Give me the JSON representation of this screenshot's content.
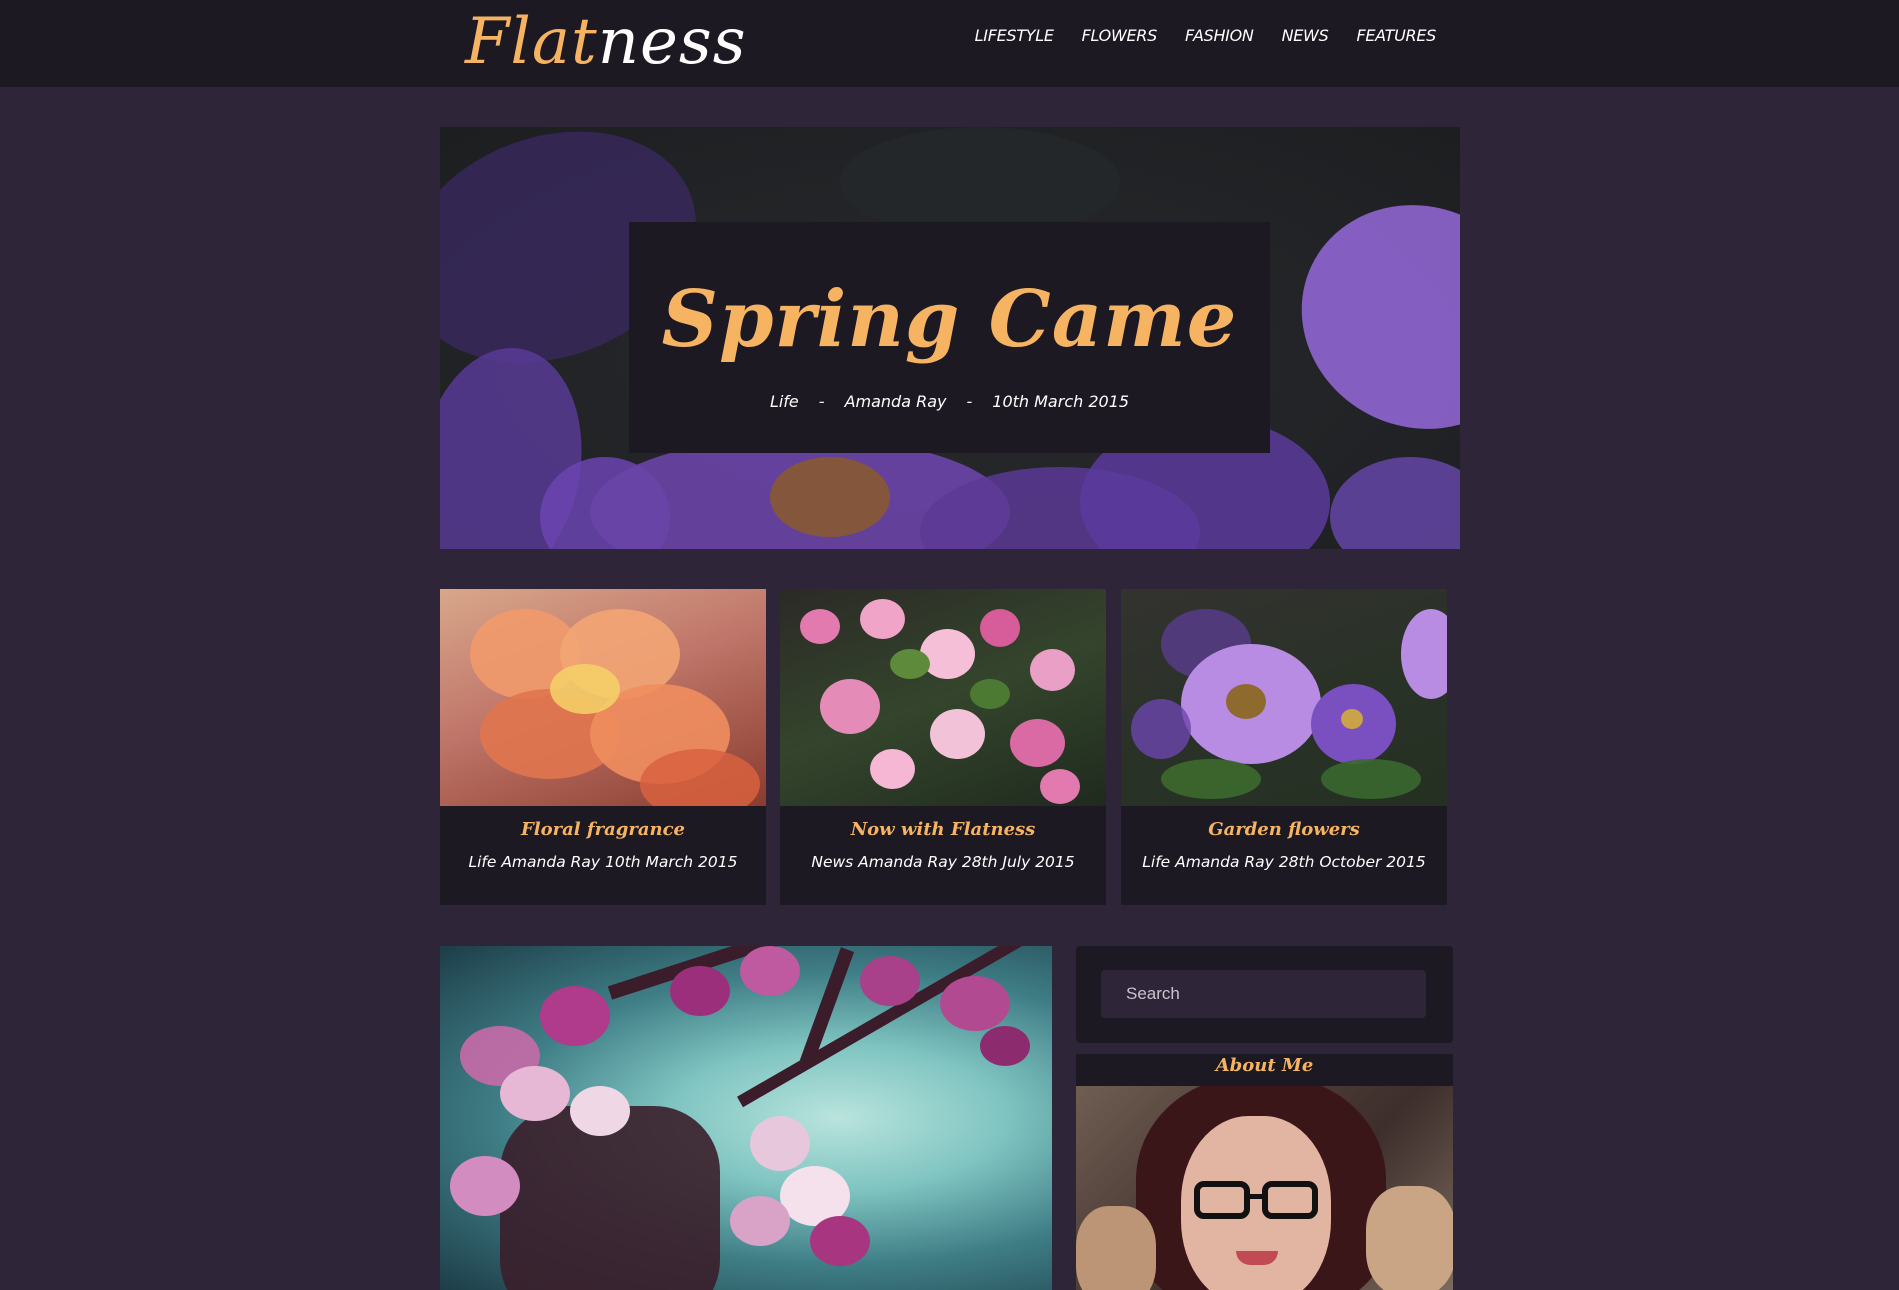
{
  "header": {
    "logo_part1": "Flat",
    "logo_part2": "ness",
    "nav": [
      "LIFESTYLE",
      "FLOWERS",
      "FASHION",
      "NEWS",
      "FEATURES"
    ]
  },
  "hero": {
    "title": "Spring Came",
    "category": "Life",
    "separator": "-",
    "author": "Amanda Ray",
    "date": "10th March 2015"
  },
  "cards": [
    {
      "title": "Floral fragrance",
      "meta": "Life Amanda Ray 10th March 2015"
    },
    {
      "title": "Now with Flatness",
      "meta": "News Amanda Ray 28th July 2015"
    },
    {
      "title": "Garden flowers",
      "meta": "Life Amanda Ray 28th October 2015"
    }
  ],
  "sidebar": {
    "search_placeholder": "Search",
    "about_title": "About Me"
  },
  "colors": {
    "accent": "#f6b463",
    "header_bg": "#1c1922",
    "page_bg": "#2e2638",
    "panel_bg": "#1c1922"
  }
}
